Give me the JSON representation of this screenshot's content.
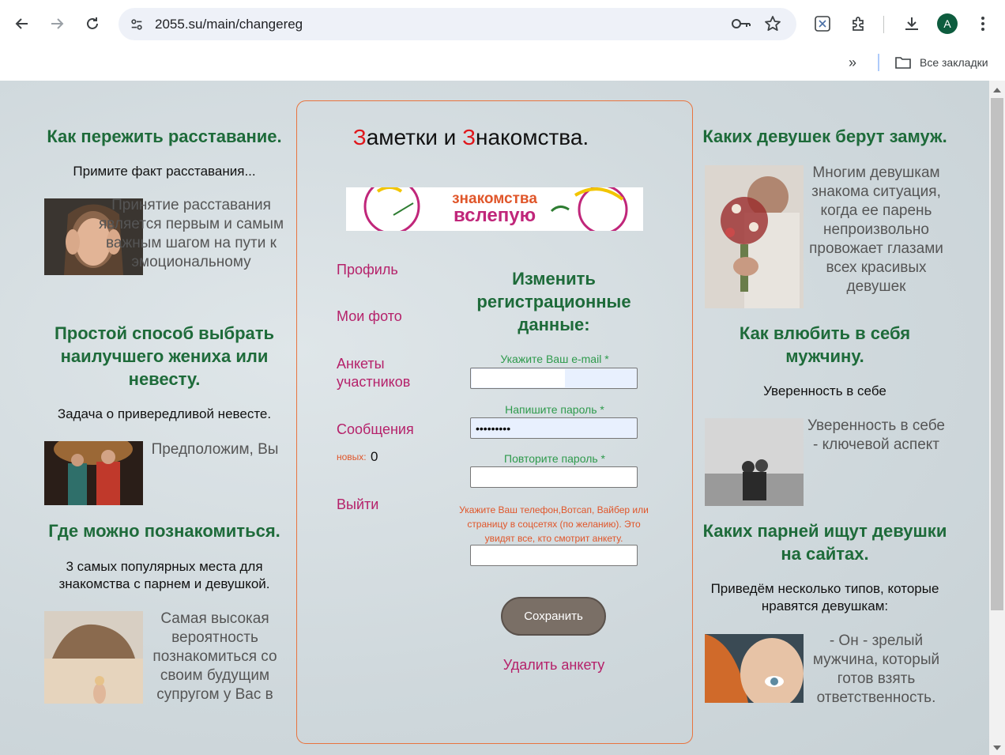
{
  "browser": {
    "url": "2055.su/main/changereg",
    "avatar_letter": "A",
    "bookmarks_label": "Все закладки"
  },
  "left": {
    "a1": {
      "heading": "Как пережить расставание.",
      "subtitle": "Примите факт расставания...",
      "text": "Принятие расставания является первым и самым важным шагом на пути к эмоциональному"
    },
    "a2": {
      "heading": "Простой способ выбрать наилучшего жениха или невесту.",
      "subtitle": "Задача о привередливой невесте.",
      "text": "Предположим, Вы"
    },
    "a3": {
      "heading": "Где можно познакомиться.",
      "subtitle": "3 самых популярных места для знакомства с парнем и девушкой.",
      "text": "Самая высокая вероятность познакомиться со своим будущим супругом у Вас в"
    }
  },
  "right": {
    "a1": {
      "heading": "Каких девушек берут замуж.",
      "text": "Многим девушкам знакома ситуация, когда ее парень непроизвольно провожает глазами всех красивых девушек"
    },
    "a2": {
      "heading": "Как влюбить в себя мужчину.",
      "subtitle": "Уверенность в себе",
      "text": "Уверенность в себе - ключевой аспект"
    },
    "a3": {
      "heading": "Каких парней ищут девушки на сайтах.",
      "subtitle": "Приведём несколько типов, которые нравятся девушкам:",
      "text": "- Он - зрелый мужчина, который готов взять ответственность."
    }
  },
  "center": {
    "title_first_letter_1": "З",
    "title_part_1": "аметки и ",
    "title_first_letter_2": "З",
    "title_part_2": "накомства.",
    "banner_line1": "знакомства",
    "banner_line2": "вслепую",
    "menu": {
      "profile": "Профиль",
      "photos": "Мои фото",
      "profiles": "Анкеты участников",
      "messages": "Сообщения",
      "new_label": "новых:",
      "new_count": "0",
      "logout": "Выйти"
    },
    "form": {
      "heading": "Изменить регистрационные данные:",
      "email_label": "Укажите Ваш e-mail *",
      "email_value": "",
      "password_label": "Напишите пароль *",
      "password_value": "•••••••••",
      "password2_label": "Повторите пароль *",
      "password2_value": "",
      "phone_note": "Укажите Ваш телефон,Вотсап, Вайбер или страницу в соцсетях (по желанию). Это увидят все, кто смотрит анкету.",
      "phone_value": "",
      "save_label": "Сохранить",
      "delete_label": "Удалить анкету"
    }
  }
}
